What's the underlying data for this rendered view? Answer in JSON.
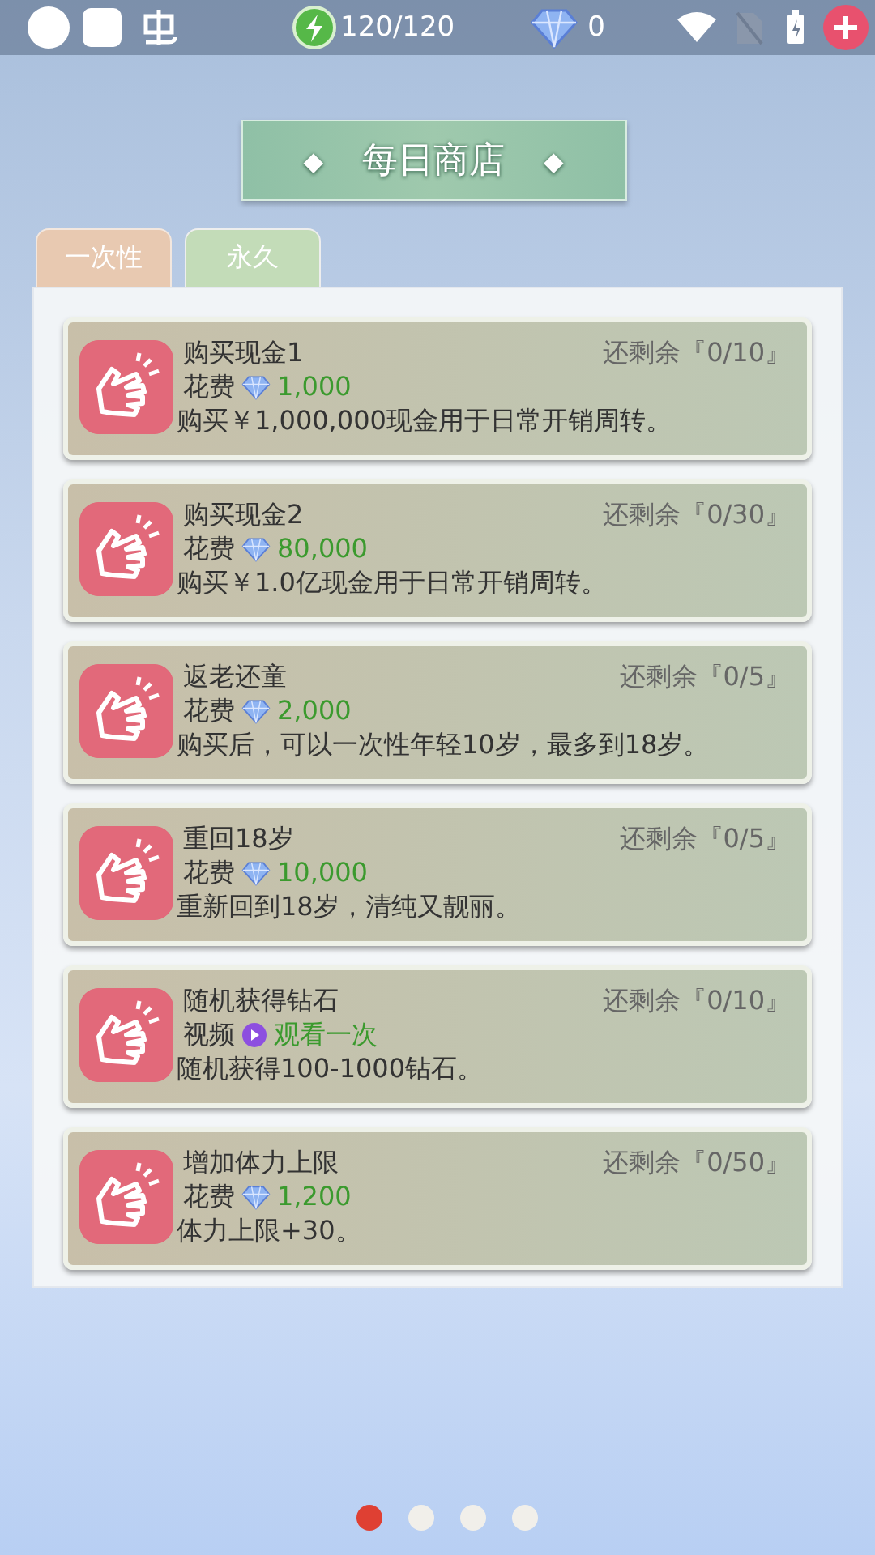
{
  "status_bar": {
    "energy": "120/120",
    "diamonds": "0"
  },
  "header": {
    "title": "每日商店",
    "left_mark": "◆",
    "right_mark": "◆"
  },
  "tabs": [
    {
      "label": "一次性",
      "selected": true
    },
    {
      "label": "永久",
      "selected": false
    }
  ],
  "items": [
    {
      "title": "购买现金1",
      "remaining": "还剩余『0/10』",
      "kind": "cost",
      "cost_label": "花费",
      "cost": "1,000",
      "description": "购买￥1,000,000现金用于日常开销周转。"
    },
    {
      "title": "购买现金2",
      "remaining": "还剩余『0/30』",
      "kind": "cost",
      "cost_label": "花费",
      "cost": "80,000",
      "description": "购买￥1.0亿现金用于日常开销周转。"
    },
    {
      "title": "返老还童",
      "remaining": "还剩余『0/5』",
      "kind": "cost",
      "cost_label": "花费",
      "cost": "2,000",
      "description": "购买后，可以一次性年轻10岁，最多到18岁。"
    },
    {
      "title": "重回18岁",
      "remaining": "还剩余『0/5』",
      "kind": "cost",
      "cost_label": "花费",
      "cost": "10,000",
      "description": "重新回到18岁，清纯又靓丽。"
    },
    {
      "title": "随机获得钻石",
      "remaining": "还剩余『0/10』",
      "kind": "video",
      "cost_label": "视频",
      "cost": "观看一次",
      "description": "随机获得100-1000钻石。"
    },
    {
      "title": "增加体力上限",
      "remaining": "还剩余『0/50』",
      "kind": "cost",
      "cost_label": "花费",
      "cost": "1,200",
      "description": "体力上限+30。"
    }
  ],
  "pager": [
    {
      "selected": true
    },
    {
      "selected": false
    },
    {
      "selected": false
    },
    {
      "selected": false
    }
  ]
}
